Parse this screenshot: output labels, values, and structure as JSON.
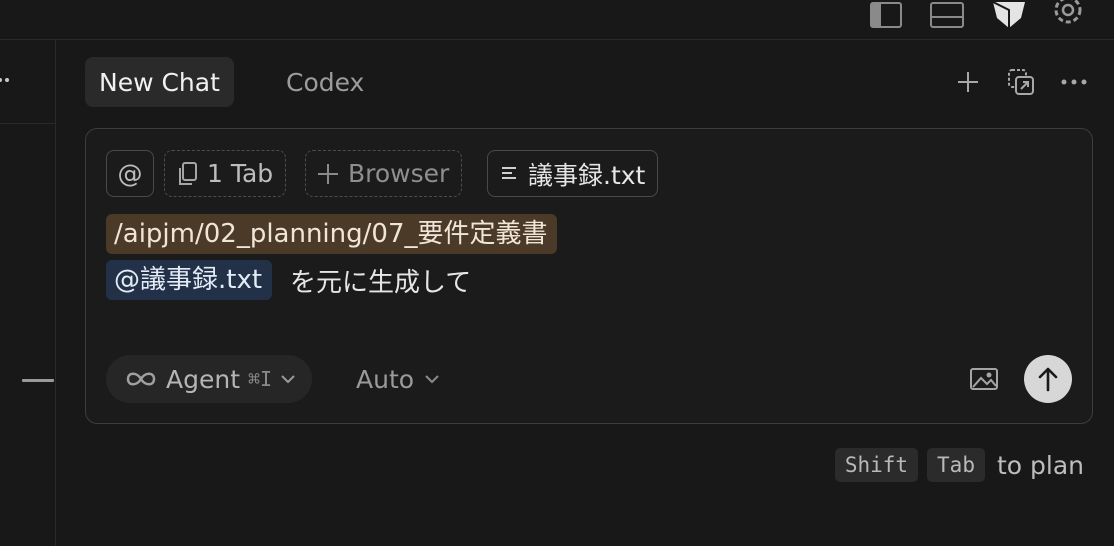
{
  "top_icons": [
    "sidebar-left-icon",
    "panel-bottom-icon",
    "cursor-logo-icon",
    "gear-icon"
  ],
  "tabs": [
    {
      "label": "New Chat",
      "active": true
    },
    {
      "label": "Codex",
      "active": false
    }
  ],
  "header_actions": [
    "plus-icon",
    "history-icon",
    "more-icon"
  ],
  "context_chips": {
    "at_symbol": "@",
    "tabs_label": "1 Tab",
    "browser_label": "Browser",
    "file_label": "議事録.txt"
  },
  "message": {
    "path_token": "/aipjm/02_planning/07_要件定義書",
    "mention_token": "@議事録.txt",
    "text": "を元に生成して"
  },
  "controls": {
    "mode_label": "Agent",
    "mode_shortcut": "⌘I",
    "model_label": "Auto"
  },
  "hint": {
    "key1": "Shift",
    "key2": "Tab",
    "text": "to plan"
  },
  "colors": {
    "background": "#181818",
    "path_token_bg": "#4a3a27",
    "mention_token_bg": "#233148",
    "send_button": "#d7d7d7"
  }
}
